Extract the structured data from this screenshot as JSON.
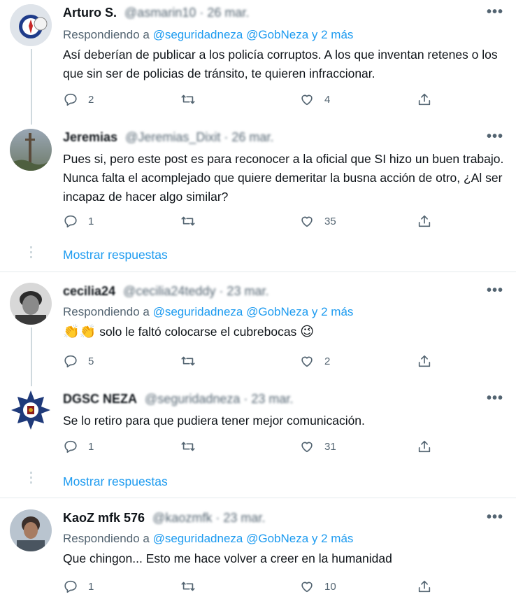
{
  "replying_prefix": "Respondiendo a",
  "show_replies_label": "Mostrar respuestas",
  "more_label": "•••",
  "tweets": [
    {
      "name": "Arturo S.",
      "handle": "@asmarin10 · 26 mar.",
      "replying_to": [
        "@seguridadneza",
        "@GobNeza",
        "y 2 más"
      ],
      "text": "Así deberían de publicar a los policía corruptos. A los que inventan retenes o los que sin ser de policias de tránsito, te quieren infraccionar.",
      "replies": "2",
      "retweets": "",
      "likes": "4"
    },
    {
      "name": "Jeremias",
      "handle": "@Jeremias_Dixit · 26 mar.",
      "text": "Pues si, pero este post es para reconocer a la oficial que SI hizo un buen trabajo. Nunca falta el acomplejado que quiere demeritar la busna acción de otro, ¿Al ser incapaz de hacer algo similar?",
      "replies": "1",
      "retweets": "",
      "likes": "35"
    },
    {
      "name": "cecilia24",
      "handle": "@cecilia24teddy · 23 mar.",
      "replying_to": [
        "@seguridadneza",
        "@GobNeza",
        "y 2 más"
      ],
      "emoji_prefix": "👏👏",
      "text": "solo le faltó colocarse el cubrebocas",
      "emoji_suffix": "😉",
      "replies": "5",
      "retweets": "",
      "likes": "2"
    },
    {
      "name": "DGSC NEZA",
      "handle": "@seguridadneza · 23 mar.",
      "text": "Se lo retiro para que pudiera tener mejor comunicación.",
      "replies": "1",
      "retweets": "",
      "likes": "31"
    },
    {
      "name": "KaoZ mfk 576",
      "handle": "@kaozmfk · 23 mar.",
      "replying_to": [
        "@seguridadneza",
        "@GobNeza",
        "y 2 más"
      ],
      "text": "Que chingon... Esto me hace volver a creer en la humanidad",
      "replies": "1",
      "retweets": "",
      "likes": "10"
    }
  ],
  "colors": {
    "accent": "#1d9bf0",
    "muted": "#536471",
    "text": "#0f1419",
    "line": "#cfd9de"
  },
  "icons": [
    "reply-icon",
    "retweet-icon",
    "like-icon",
    "share-icon",
    "more-icon"
  ]
}
